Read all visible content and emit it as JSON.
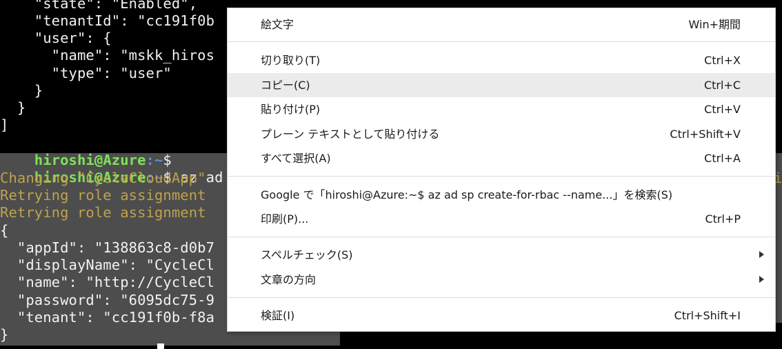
{
  "terminal": {
    "lines": [
      "    \"state\": \"Enabled\",",
      "    \"tenantId\": \"cc191f0b",
      "    \"user\": {",
      "      \"name\": \"mskk_hiros",
      "      \"type\": \"user\"",
      "    }",
      "  }",
      "]"
    ],
    "prompt_user": "hiroshi@Azure",
    "prompt_path": ":~",
    "prompt_symbol": "$",
    "command": " az ad sp",
    "selected_lines": [
      "Changing \"CycleCloudApp\"",
      "Retrying role assignment",
      "Retrying role assignment",
      "{",
      "  \"appId\": \"138863c8-d0b7",
      "  \"displayName\": \"CycleCl",
      "  \"name\": \"http://CycleCl",
      "  \"password\": \"6095dc75-9",
      "  \"tenant\": \"cc191f0b-f8a",
      "}"
    ],
    "right_fragment": "i"
  },
  "context_menu": {
    "items": [
      {
        "label": "絵文字",
        "shortcut": "Win+期間"
      },
      {
        "label": "切り取り(T)",
        "shortcut": "Ctrl+X"
      },
      {
        "label": "コピー(C)",
        "shortcut": "Ctrl+C"
      },
      {
        "label": "貼り付け(P)",
        "shortcut": "Ctrl+V"
      },
      {
        "label": "プレーン テキストとして貼り付ける",
        "shortcut": "Ctrl+Shift+V"
      },
      {
        "label": "すべて選択(A)",
        "shortcut": "Ctrl+A"
      },
      {
        "label": "Google で「hiroshi@Azure:~$ az ad sp create-for-rbac --name...」を検索(S)",
        "shortcut": ""
      },
      {
        "label": "印刷(P)...",
        "shortcut": "Ctrl+P"
      },
      {
        "label": "スペルチェック(S)",
        "shortcut": ""
      },
      {
        "label": "文章の方向",
        "shortcut": ""
      },
      {
        "label": "検証(I)",
        "shortcut": "Ctrl+Shift+I"
      }
    ],
    "hovered_item": "コピー(C)",
    "submenu_arrow_icon": "chevron-right-icon"
  },
  "colors": {
    "prompt_user": "#7fe357",
    "prompt_path": "#5b8dd6",
    "warning_text": "#c0a24b",
    "selection_bg": "#4d4d4d",
    "menu_hover": "#ebebeb"
  }
}
